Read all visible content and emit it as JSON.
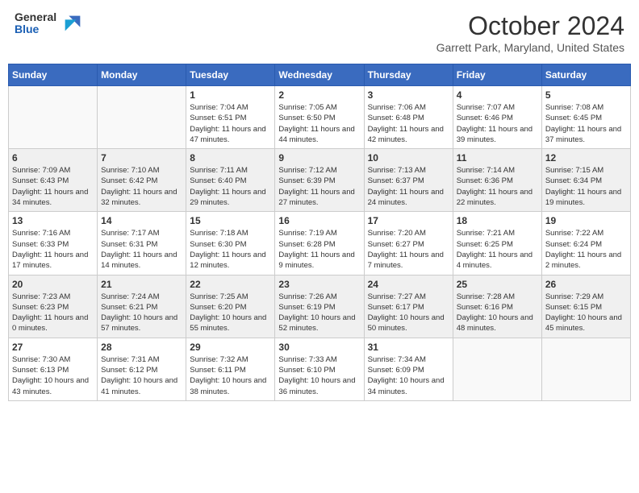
{
  "header": {
    "logo_general": "General",
    "logo_blue": "Blue",
    "title": "October 2024",
    "location": "Garrett Park, Maryland, United States"
  },
  "days_of_week": [
    "Sunday",
    "Monday",
    "Tuesday",
    "Wednesday",
    "Thursday",
    "Friday",
    "Saturday"
  ],
  "weeks": [
    [
      {
        "day": "",
        "sunrise": "",
        "sunset": "",
        "daylight": ""
      },
      {
        "day": "",
        "sunrise": "",
        "sunset": "",
        "daylight": ""
      },
      {
        "day": "1",
        "sunrise": "Sunrise: 7:04 AM",
        "sunset": "Sunset: 6:51 PM",
        "daylight": "Daylight: 11 hours and 47 minutes."
      },
      {
        "day": "2",
        "sunrise": "Sunrise: 7:05 AM",
        "sunset": "Sunset: 6:50 PM",
        "daylight": "Daylight: 11 hours and 44 minutes."
      },
      {
        "day": "3",
        "sunrise": "Sunrise: 7:06 AM",
        "sunset": "Sunset: 6:48 PM",
        "daylight": "Daylight: 11 hours and 42 minutes."
      },
      {
        "day": "4",
        "sunrise": "Sunrise: 7:07 AM",
        "sunset": "Sunset: 6:46 PM",
        "daylight": "Daylight: 11 hours and 39 minutes."
      },
      {
        "day": "5",
        "sunrise": "Sunrise: 7:08 AM",
        "sunset": "Sunset: 6:45 PM",
        "daylight": "Daylight: 11 hours and 37 minutes."
      }
    ],
    [
      {
        "day": "6",
        "sunrise": "Sunrise: 7:09 AM",
        "sunset": "Sunset: 6:43 PM",
        "daylight": "Daylight: 11 hours and 34 minutes."
      },
      {
        "day": "7",
        "sunrise": "Sunrise: 7:10 AM",
        "sunset": "Sunset: 6:42 PM",
        "daylight": "Daylight: 11 hours and 32 minutes."
      },
      {
        "day": "8",
        "sunrise": "Sunrise: 7:11 AM",
        "sunset": "Sunset: 6:40 PM",
        "daylight": "Daylight: 11 hours and 29 minutes."
      },
      {
        "day": "9",
        "sunrise": "Sunrise: 7:12 AM",
        "sunset": "Sunset: 6:39 PM",
        "daylight": "Daylight: 11 hours and 27 minutes."
      },
      {
        "day": "10",
        "sunrise": "Sunrise: 7:13 AM",
        "sunset": "Sunset: 6:37 PM",
        "daylight": "Daylight: 11 hours and 24 minutes."
      },
      {
        "day": "11",
        "sunrise": "Sunrise: 7:14 AM",
        "sunset": "Sunset: 6:36 PM",
        "daylight": "Daylight: 11 hours and 22 minutes."
      },
      {
        "day": "12",
        "sunrise": "Sunrise: 7:15 AM",
        "sunset": "Sunset: 6:34 PM",
        "daylight": "Daylight: 11 hours and 19 minutes."
      }
    ],
    [
      {
        "day": "13",
        "sunrise": "Sunrise: 7:16 AM",
        "sunset": "Sunset: 6:33 PM",
        "daylight": "Daylight: 11 hours and 17 minutes."
      },
      {
        "day": "14",
        "sunrise": "Sunrise: 7:17 AM",
        "sunset": "Sunset: 6:31 PM",
        "daylight": "Daylight: 11 hours and 14 minutes."
      },
      {
        "day": "15",
        "sunrise": "Sunrise: 7:18 AM",
        "sunset": "Sunset: 6:30 PM",
        "daylight": "Daylight: 11 hours and 12 minutes."
      },
      {
        "day": "16",
        "sunrise": "Sunrise: 7:19 AM",
        "sunset": "Sunset: 6:28 PM",
        "daylight": "Daylight: 11 hours and 9 minutes."
      },
      {
        "day": "17",
        "sunrise": "Sunrise: 7:20 AM",
        "sunset": "Sunset: 6:27 PM",
        "daylight": "Daylight: 11 hours and 7 minutes."
      },
      {
        "day": "18",
        "sunrise": "Sunrise: 7:21 AM",
        "sunset": "Sunset: 6:25 PM",
        "daylight": "Daylight: 11 hours and 4 minutes."
      },
      {
        "day": "19",
        "sunrise": "Sunrise: 7:22 AM",
        "sunset": "Sunset: 6:24 PM",
        "daylight": "Daylight: 11 hours and 2 minutes."
      }
    ],
    [
      {
        "day": "20",
        "sunrise": "Sunrise: 7:23 AM",
        "sunset": "Sunset: 6:23 PM",
        "daylight": "Daylight: 11 hours and 0 minutes."
      },
      {
        "day": "21",
        "sunrise": "Sunrise: 7:24 AM",
        "sunset": "Sunset: 6:21 PM",
        "daylight": "Daylight: 10 hours and 57 minutes."
      },
      {
        "day": "22",
        "sunrise": "Sunrise: 7:25 AM",
        "sunset": "Sunset: 6:20 PM",
        "daylight": "Daylight: 10 hours and 55 minutes."
      },
      {
        "day": "23",
        "sunrise": "Sunrise: 7:26 AM",
        "sunset": "Sunset: 6:19 PM",
        "daylight": "Daylight: 10 hours and 52 minutes."
      },
      {
        "day": "24",
        "sunrise": "Sunrise: 7:27 AM",
        "sunset": "Sunset: 6:17 PM",
        "daylight": "Daylight: 10 hours and 50 minutes."
      },
      {
        "day": "25",
        "sunrise": "Sunrise: 7:28 AM",
        "sunset": "Sunset: 6:16 PM",
        "daylight": "Daylight: 10 hours and 48 minutes."
      },
      {
        "day": "26",
        "sunrise": "Sunrise: 7:29 AM",
        "sunset": "Sunset: 6:15 PM",
        "daylight": "Daylight: 10 hours and 45 minutes."
      }
    ],
    [
      {
        "day": "27",
        "sunrise": "Sunrise: 7:30 AM",
        "sunset": "Sunset: 6:13 PM",
        "daylight": "Daylight: 10 hours and 43 minutes."
      },
      {
        "day": "28",
        "sunrise": "Sunrise: 7:31 AM",
        "sunset": "Sunset: 6:12 PM",
        "daylight": "Daylight: 10 hours and 41 minutes."
      },
      {
        "day": "29",
        "sunrise": "Sunrise: 7:32 AM",
        "sunset": "Sunset: 6:11 PM",
        "daylight": "Daylight: 10 hours and 38 minutes."
      },
      {
        "day": "30",
        "sunrise": "Sunrise: 7:33 AM",
        "sunset": "Sunset: 6:10 PM",
        "daylight": "Daylight: 10 hours and 36 minutes."
      },
      {
        "day": "31",
        "sunrise": "Sunrise: 7:34 AM",
        "sunset": "Sunset: 6:09 PM",
        "daylight": "Daylight: 10 hours and 34 minutes."
      },
      {
        "day": "",
        "sunrise": "",
        "sunset": "",
        "daylight": ""
      },
      {
        "day": "",
        "sunrise": "",
        "sunset": "",
        "daylight": ""
      }
    ]
  ]
}
